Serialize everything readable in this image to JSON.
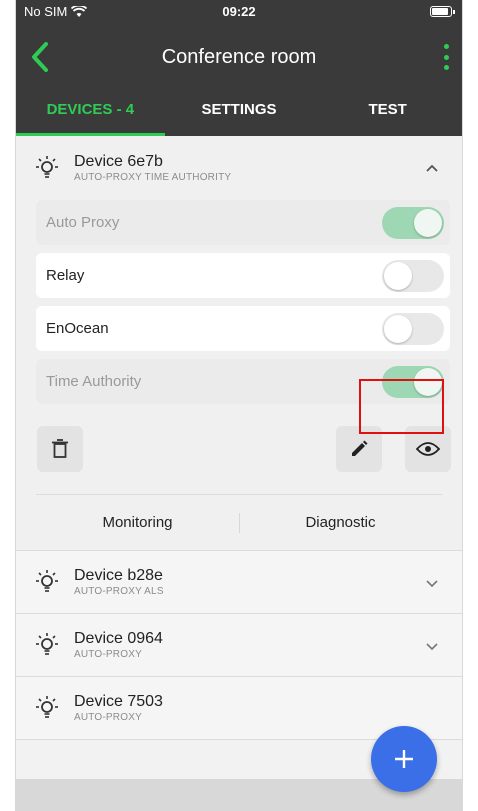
{
  "status_bar": {
    "carrier": "No SIM",
    "time": "09:22"
  },
  "header": {
    "title": "Conference room"
  },
  "tabs": [
    {
      "label": "DEVICES - 4",
      "active": true
    },
    {
      "label": "SETTINGS",
      "active": false
    },
    {
      "label": "TEST",
      "active": false
    }
  ],
  "colors": {
    "accent": "#2ecc55",
    "header_bg": "#3a3a3a",
    "toggle_on": "#9dd7b4",
    "fab": "#3b6fe8"
  },
  "expanded_device": {
    "name": "Device 6e7b",
    "tags": "AUTO-PROXY  TIME AUTHORITY",
    "settings": [
      {
        "label": "Auto Proxy",
        "on": true,
        "disabled": true
      },
      {
        "label": "Relay",
        "on": false,
        "disabled": false
      },
      {
        "label": "EnOcean",
        "on": false,
        "disabled": false
      },
      {
        "label": "Time Authority",
        "on": true,
        "disabled": true
      }
    ],
    "sub_tabs": {
      "monitoring": "Monitoring",
      "diagnostic": "Diagnostic"
    }
  },
  "devices": [
    {
      "name": "Device b28e",
      "tags": "AUTO-PROXY  ALS"
    },
    {
      "name": "Device 0964",
      "tags": "AUTO-PROXY"
    },
    {
      "name": "Device 7503",
      "tags": "AUTO-PROXY"
    }
  ],
  "icons": {
    "back": "chevron-left-icon",
    "menu": "more-vert-icon",
    "device": "lightbulb-icon",
    "expand": "chevron-up-icon",
    "collapse": "chevron-down-icon",
    "delete": "trash-icon",
    "edit": "pencil-icon",
    "view": "eye-icon",
    "add": "plus-icon"
  }
}
